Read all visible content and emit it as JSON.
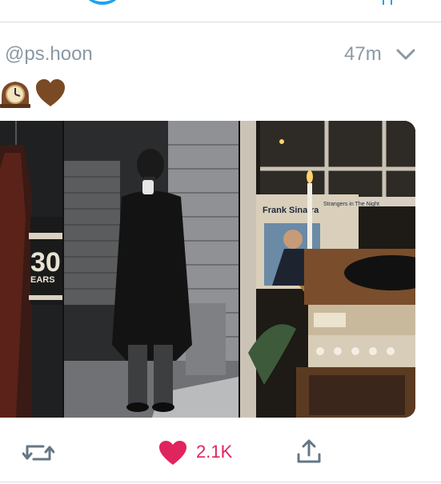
{
  "tweet": {
    "handle": "@ps.hoon",
    "time": "47m",
    "emojis": [
      "mantelpiece-clock",
      "brown-heart"
    ]
  },
  "media": {
    "panels": [
      "jacket-closeup",
      "person-in-long-coat-by-brick-wall",
      "record-player-and-candle-by-window"
    ],
    "sleeve_text": {
      "artist": "Frank Sinatra",
      "album": "Strangers in The Night",
      "jacket_number": "30",
      "jacket_text": "EARS"
    }
  },
  "actions": {
    "like_count": "2.1K",
    "like_color": "#e0245e",
    "icon_color": "#657786"
  }
}
